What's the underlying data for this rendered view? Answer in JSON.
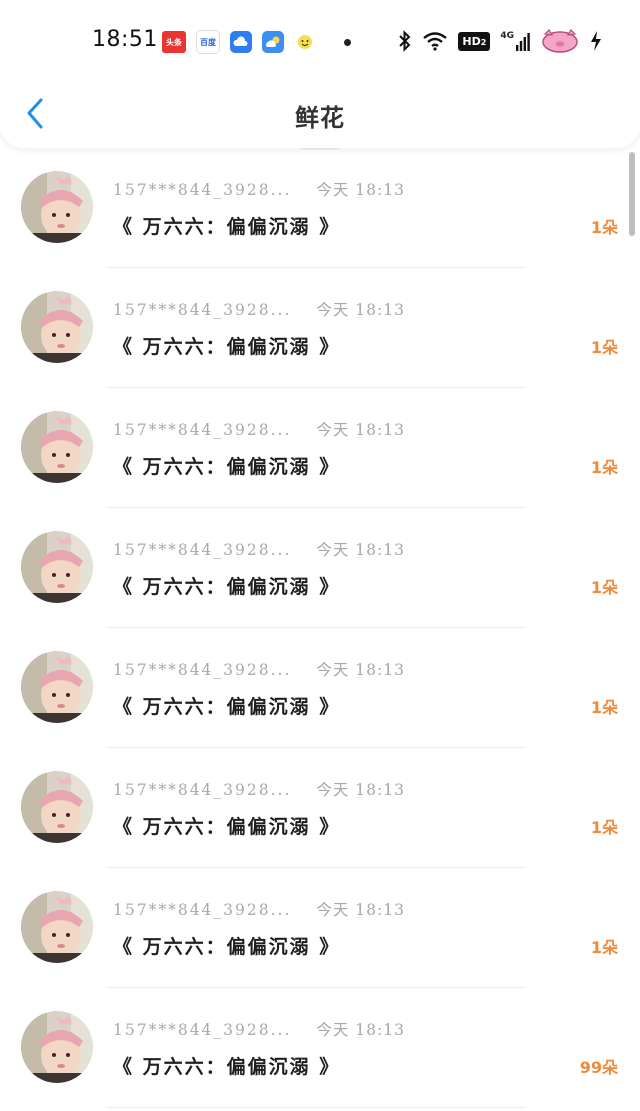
{
  "status_bar": {
    "time": "18:51",
    "apps": [
      "头条",
      "百度",
      "",
      "",
      ""
    ],
    "hd_label": "HD",
    "network": "4G"
  },
  "nav": {
    "title": "鲜花",
    "back_icon": "chevron-left-icon"
  },
  "colors": {
    "accent": "#ee8a3c",
    "back": "#1f8fe8"
  },
  "list": [
    {
      "user": "157***844_3928...",
      "time": "今天 18:13",
      "title": "《 万六六：偏偏沉溺 》",
      "count": "1朵"
    },
    {
      "user": "157***844_3928...",
      "time": "今天 18:13",
      "title": "《 万六六：偏偏沉溺 》",
      "count": "1朵"
    },
    {
      "user": "157***844_3928...",
      "time": "今天 18:13",
      "title": "《 万六六：偏偏沉溺 》",
      "count": "1朵"
    },
    {
      "user": "157***844_3928...",
      "time": "今天 18:13",
      "title": "《 万六六：偏偏沉溺 》",
      "count": "1朵"
    },
    {
      "user": "157***844_3928...",
      "time": "今天 18:13",
      "title": "《 万六六：偏偏沉溺 》",
      "count": "1朵"
    },
    {
      "user": "157***844_3928...",
      "time": "今天 18:13",
      "title": "《 万六六：偏偏沉溺 》",
      "count": "1朵"
    },
    {
      "user": "157***844_3928...",
      "time": "今天 18:13",
      "title": "《 万六六：偏偏沉溺 》",
      "count": "1朵"
    },
    {
      "user": "157***844_3928...",
      "time": "今天 18:13",
      "title": "《 万六六：偏偏沉溺 》",
      "count": "99朵"
    }
  ]
}
